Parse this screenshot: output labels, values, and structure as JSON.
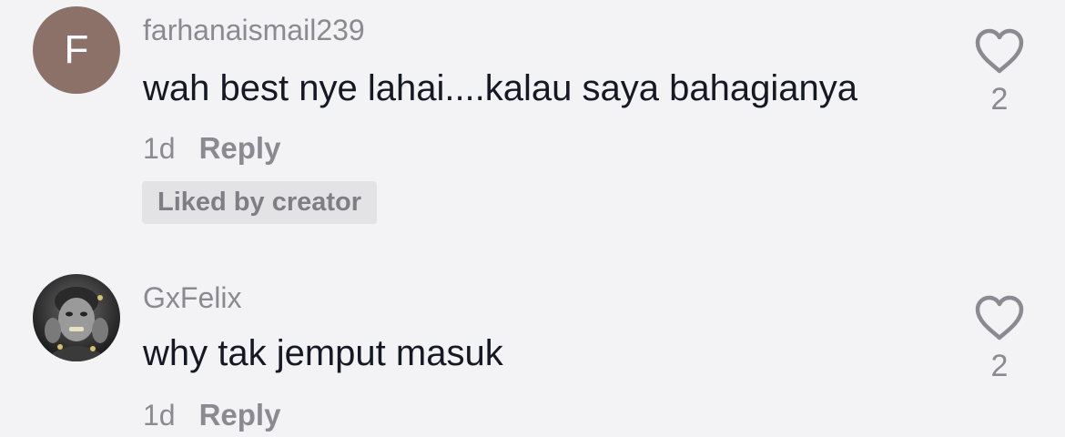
{
  "comments": [
    {
      "avatar_letter": "F",
      "avatar_color": "#8b7168",
      "username": "farhanaismail239",
      "text": "wah best nye lahai....kalau saya bahagianya",
      "time": "1d",
      "reply_label": "Reply",
      "badge": "Liked by creator",
      "likes": "2",
      "like_icon": "heart-outline-icon"
    },
    {
      "avatar_icon": "profile-photo",
      "username": "GxFelix",
      "text": "why tak jemput masuk",
      "time": "1d",
      "reply_label": "Reply",
      "likes": "2",
      "like_icon": "heart-outline-icon"
    }
  ],
  "colors": {
    "background": "#f3f3f5",
    "primary_text": "#161823",
    "secondary_text": "#8a8a90",
    "badge_background": "#e3e3e6"
  }
}
